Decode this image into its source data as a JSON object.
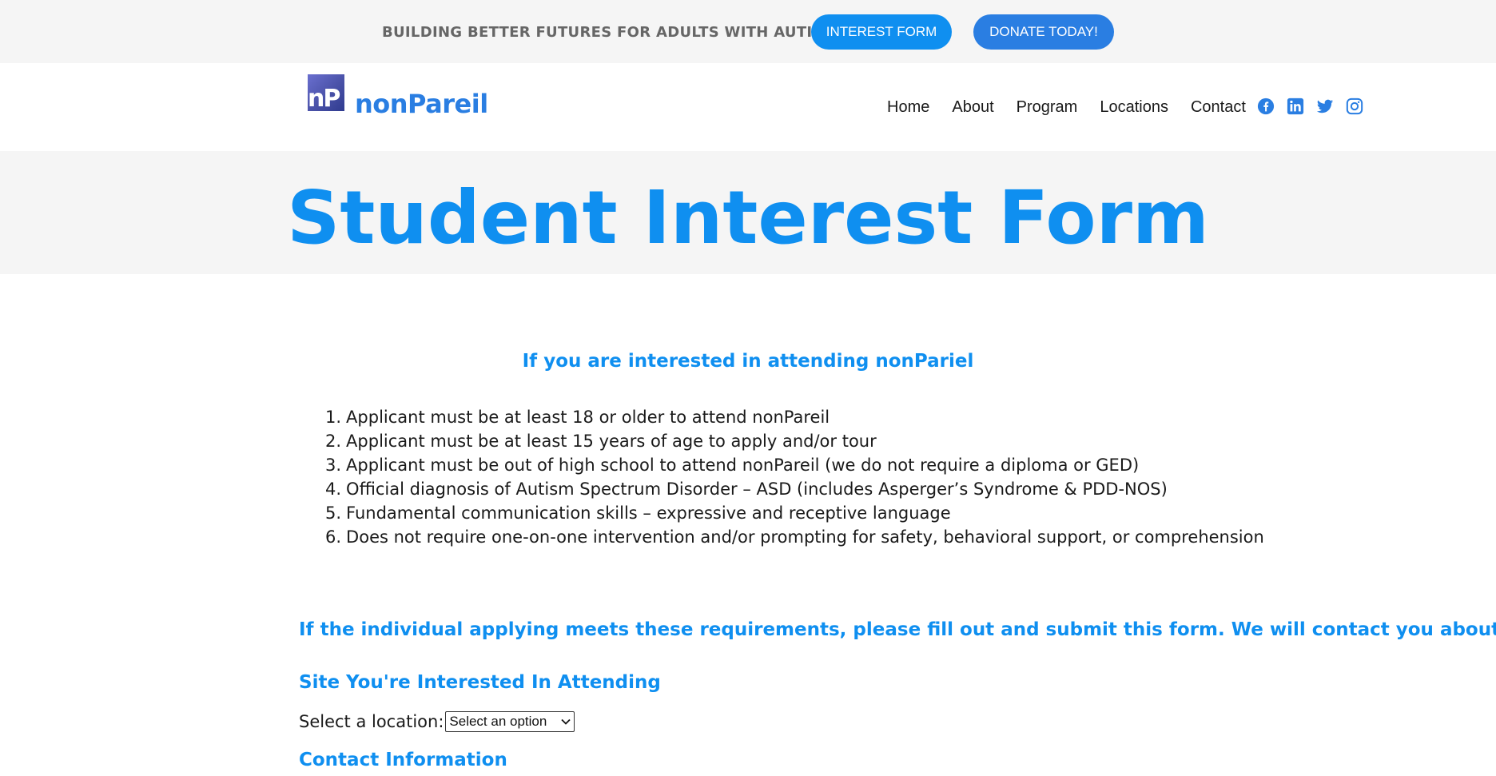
{
  "topbar": {
    "tagline": "BUILDING BETTER FUTURES FOR ADULTS WITH AUTISM",
    "interest_button": "INTEREST FORM",
    "donate_button": "DONATE TODAY!"
  },
  "header": {
    "logo_mark": "nP",
    "logo_text": "nonPareil",
    "nav": {
      "home": "Home",
      "about": "About",
      "program": "Program",
      "locations": "Locations",
      "contact": "Contact"
    },
    "social_icons": [
      "facebook-icon",
      "linkedin-icon",
      "twitter-icon",
      "instagram-icon"
    ]
  },
  "title": "Student Interest Form",
  "intro_heading": "If you are interested in attending nonPariel",
  "requirements": [
    {
      "num": "1.",
      "text": "Applicant must be at least 18 or older to attend nonPareil"
    },
    {
      "num": "2.",
      "text": "Applicant must be at least 15 years of age to apply and/or tour"
    },
    {
      "num": "3.",
      "text": "Applicant must be out of high school to attend nonPareil (we do not require a diploma or GED)"
    },
    {
      "num": "4.",
      "text": "Official diagnosis of Autism Spectrum Disorder – ASD (includes Asperger’s Syndrome & PDD-NOS)"
    },
    {
      "num": "5.",
      "text": "Fundamental communication skills – expressive and receptive language"
    },
    {
      "num": "6.",
      "text": "Does not require one-on-one intervention and/or prompting for safety, behavioral support, or comprehension"
    }
  ],
  "cta_heading": "If the individual applying meets these requirements, please fill out and submit this form. We will contact you about your interest",
  "site_heading": "Site You're Interested In Attending",
  "location_label": "Select a location:",
  "location_select_value": "Select an option",
  "contact_heading": "Contact Information",
  "colors": {
    "accent": "#0f8ff0",
    "donate": "#2a7ee2",
    "band": "#f5f5f5"
  }
}
